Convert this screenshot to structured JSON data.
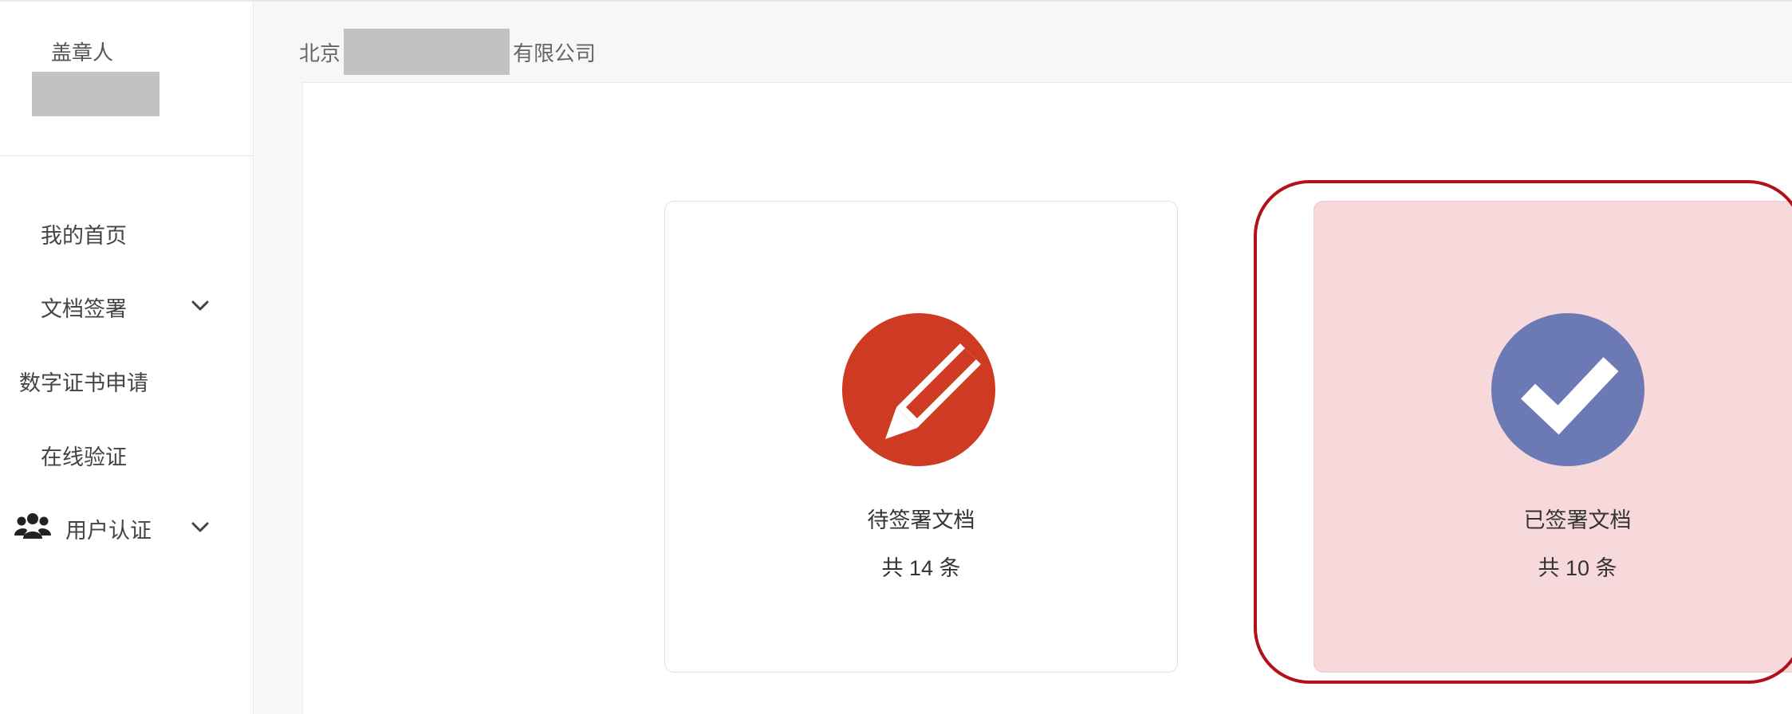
{
  "sidebar": {
    "seal_label": "盖章人",
    "menu": [
      {
        "label": "我的首页"
      },
      {
        "label": "文档签署",
        "has_dropdown": true,
        "dropdown_icon": "chevron-down-icon"
      },
      {
        "label": "数字证书申请"
      },
      {
        "label": "在线验证"
      },
      {
        "label": "用户认证",
        "has_dropdown": true,
        "icon": "users-icon",
        "dropdown_icon": "chevron-down-icon"
      }
    ]
  },
  "breadcrumb": {
    "prefix": "北京",
    "suffix": "有限公司"
  },
  "cards": {
    "pending": {
      "title": "待签署文档",
      "count_text": "共 14 条",
      "icon": "pencil-edit-icon",
      "icon_color": "#cf3a22"
    },
    "signed": {
      "title": "已签署文档",
      "count_text": "共 10 条",
      "icon": "check-circle-icon",
      "icon_color": "#6b7ab5"
    }
  },
  "colors": {
    "highlight_border": "#b3101a",
    "highlight_fill": "#f8d9db"
  }
}
